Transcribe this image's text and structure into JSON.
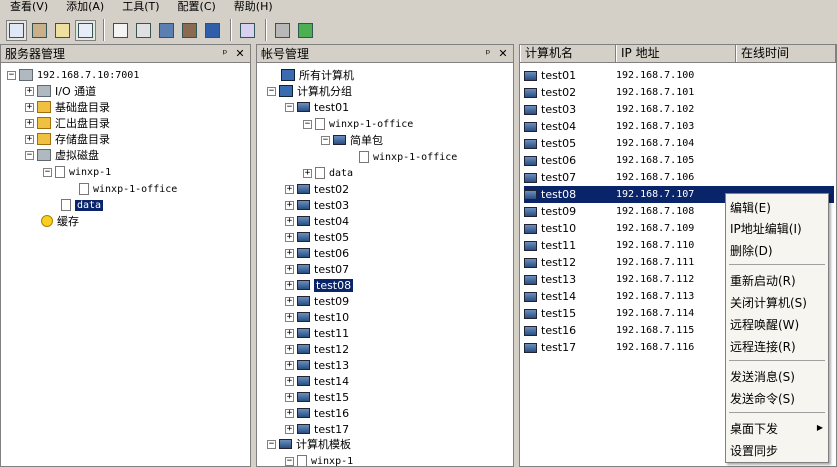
{
  "menubar": [
    "查看(V)",
    "添加(A)",
    "工具(T)",
    "配置(C)",
    "帮助(H)"
  ],
  "toolbar": {
    "groups": [
      [
        "view-tree-icon",
        "view-users-icon",
        "view-log-icon",
        "view-list-icon"
      ],
      [
        "add-disk-icon",
        "add-image-icon",
        "add-computer-icon",
        "add-user-icon",
        "remote-desktop-icon"
      ],
      [
        "calc-icon"
      ],
      [
        "tools-icon",
        "refresh-icon"
      ]
    ]
  },
  "server_panel": {
    "title": "服务器管理",
    "pin": "ᵖ",
    "close": "✕",
    "nodes": [
      {
        "label": "192.168.7.10:7001",
        "mono": true
      },
      {
        "label": "I/O 通道"
      },
      {
        "label": "基础盘目录"
      },
      {
        "label": "汇出盘目录"
      },
      {
        "label": "存储盘目录"
      },
      {
        "label": "虚拟磁盘"
      },
      {
        "label": "winxp-1",
        "mono": true
      },
      {
        "label": "winxp-1-office",
        "mono": true
      },
      {
        "label": "data",
        "mono": true
      },
      {
        "label": "缓存"
      }
    ]
  },
  "account_panel": {
    "title": "帐号管理",
    "pin": "ᵖ",
    "close": "✕",
    "nodes": [
      {
        "label": "所有计算机"
      },
      {
        "label": "计算机分组"
      },
      {
        "label": "test01"
      },
      {
        "label": "winxp-1-office"
      },
      {
        "label": "简单包"
      },
      {
        "label": "winxp-1-office"
      },
      {
        "label": "data"
      },
      {
        "label": "test02"
      },
      {
        "label": "test03"
      },
      {
        "label": "test04"
      },
      {
        "label": "test05"
      },
      {
        "label": "test06"
      },
      {
        "label": "test07"
      },
      {
        "label": "test08"
      },
      {
        "label": "test09"
      },
      {
        "label": "test10"
      },
      {
        "label": "test11"
      },
      {
        "label": "test12"
      },
      {
        "label": "test13"
      },
      {
        "label": "test14"
      },
      {
        "label": "test15"
      },
      {
        "label": "test16"
      },
      {
        "label": "test17"
      },
      {
        "label": "计算机模板"
      },
      {
        "label": "winxp-1"
      }
    ]
  },
  "list": {
    "columns": [
      "计算机名",
      "IP 地址",
      "在线时间"
    ],
    "rows": [
      {
        "name": "test01",
        "ip": "192.168.7.100"
      },
      {
        "name": "test02",
        "ip": "192.168.7.101"
      },
      {
        "name": "test03",
        "ip": "192.168.7.102"
      },
      {
        "name": "test04",
        "ip": "192.168.7.103"
      },
      {
        "name": "test05",
        "ip": "192.168.7.104"
      },
      {
        "name": "test06",
        "ip": "192.168.7.105"
      },
      {
        "name": "test07",
        "ip": "192.168.7.106"
      },
      {
        "name": "test08",
        "ip": "192.168.7.107"
      },
      {
        "name": "test09",
        "ip": "192.168.7.108"
      },
      {
        "name": "test10",
        "ip": "192.168.7.109"
      },
      {
        "name": "test11",
        "ip": "192.168.7.110"
      },
      {
        "name": "test12",
        "ip": "192.168.7.111"
      },
      {
        "name": "test13",
        "ip": "192.168.7.112"
      },
      {
        "name": "test14",
        "ip": "192.168.7.113"
      },
      {
        "name": "test15",
        "ip": "192.168.7.114"
      },
      {
        "name": "test16",
        "ip": "192.168.7.115"
      },
      {
        "name": "test17",
        "ip": "192.168.7.116"
      }
    ]
  },
  "context_menu": [
    "编辑(E)",
    "IP地址编辑(I)",
    "删除(D)",
    "重新启动(R)",
    "关闭计算机(S)",
    "远程唤醒(W)",
    "远程连接(R)",
    "发送消息(S)",
    "发送命令(S)",
    "桌面下发",
    "设置同步"
  ],
  "submenu_arrow": "▶"
}
